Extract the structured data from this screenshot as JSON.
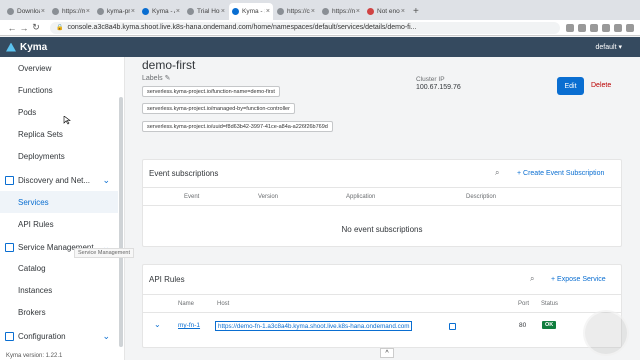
{
  "browser": {
    "tabs": [
      {
        "label": "Downloa",
        "fav": "gray"
      },
      {
        "label": "https://m",
        "fav": "gray"
      },
      {
        "label": "kyma-pro",
        "fav": "gray"
      },
      {
        "label": "Kyma - A",
        "fav": "blue"
      },
      {
        "label": "Trial Hom",
        "fav": "gray"
      },
      {
        "label": "Kyma - S",
        "fav": "blue",
        "active": true
      },
      {
        "label": "https://c",
        "fav": "gray"
      },
      {
        "label": "https://n",
        "fav": "gray"
      },
      {
        "label": "Not enou",
        "fav": "red"
      }
    ],
    "url": "console.a3c8a4b.kyma.shoot.live.k8s-hana.ondemand.com/home/namespaces/default/services/details/demo-fi..."
  },
  "header": {
    "brand": "Kyma",
    "namespace": "default ▾"
  },
  "sidebar": {
    "items": [
      {
        "label": "Overview"
      },
      {
        "label": "Functions"
      },
      {
        "label": "Pods"
      },
      {
        "label": "Replica Sets"
      },
      {
        "label": "Deployments"
      },
      {
        "label": "Discovery and Net...",
        "group": true
      },
      {
        "label": "Services",
        "active": true
      },
      {
        "label": "API Rules"
      },
      {
        "label": "Service Management",
        "group": true
      },
      {
        "label": "Catalog"
      },
      {
        "label": "Instances"
      },
      {
        "label": "Brokers"
      },
      {
        "label": "Configuration",
        "group": true
      }
    ],
    "tooltip": "Service Management",
    "version": "Kyma version: 1.22.1"
  },
  "service": {
    "name": "demo-first",
    "labels_title": "Labels",
    "labels": [
      "serverless.kyma-project.io/function-name=demo-first",
      "serverless.kyma-project.io/managed-by=function-controller",
      "serverless.kyma-project.io/uuid=f8d63b42-3997-41ce-a84a-a226f26b769d"
    ],
    "cluster_ip_label": "Cluster IP",
    "cluster_ip": "100.67.159.76",
    "edit": "Edit",
    "delete": "Delete"
  },
  "event_subscriptions": {
    "title": "Event subscriptions",
    "create": "+ Create Event Subscription",
    "columns": [
      "Event",
      "Version",
      "Application",
      "Description"
    ],
    "empty": "No event subscriptions"
  },
  "api_rules": {
    "title": "API Rules",
    "expose": "+ Expose Service",
    "columns": [
      "Name",
      "Host",
      "Port",
      "Status"
    ],
    "rows": [
      {
        "name": "my-fn-1",
        "host": "https://demo-fn-1.a3c8a4b.kyma.shoot.live.k8s-hana.ondemand.com",
        "port": "80",
        "status": "OK"
      }
    ]
  },
  "colors": {
    "accent": "#0a6ed1",
    "shell": "#354a5f",
    "ok": "#107e3e",
    "danger": "#bb0000"
  }
}
